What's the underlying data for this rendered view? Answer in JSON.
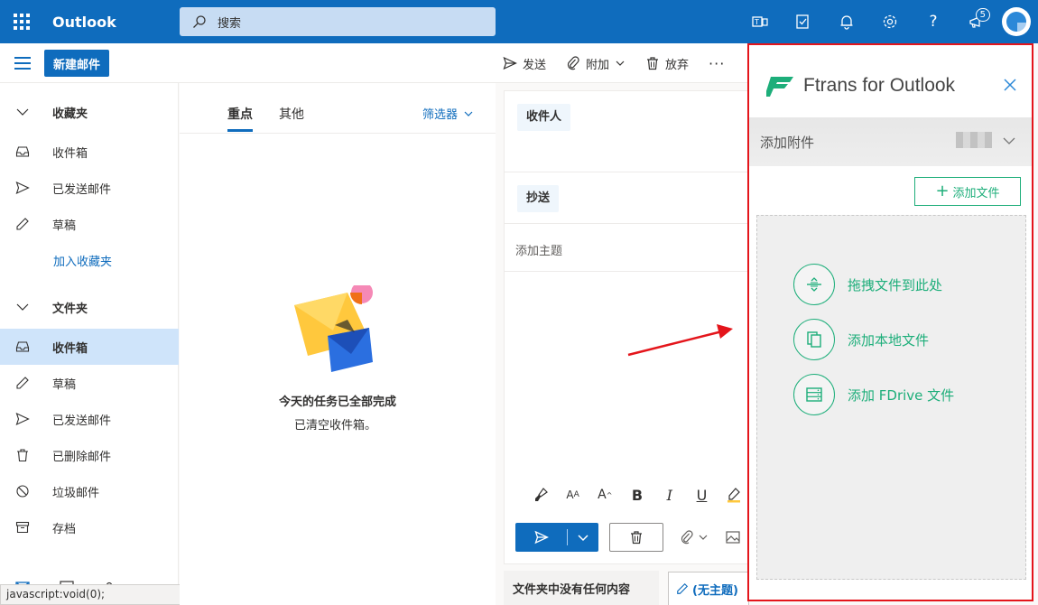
{
  "topbar": {
    "app_name": "Outlook",
    "search_placeholder": "搜索",
    "notification_count": "5"
  },
  "toolbar": {
    "new_mail": "新建邮件",
    "send": "发送",
    "attach": "附加",
    "discard": "放弃",
    "more": "···"
  },
  "sidebar": {
    "favorites_header": "收藏夹",
    "favorites": [
      {
        "label": "收件箱",
        "icon": "inbox-icon"
      },
      {
        "label": "已发送邮件",
        "icon": "send-icon"
      },
      {
        "label": "草稿",
        "icon": "pencil-icon"
      }
    ],
    "add_favorite": "加入收藏夹",
    "folders_header": "文件夹",
    "folders": [
      {
        "label": "收件箱",
        "icon": "inbox-icon"
      },
      {
        "label": "草稿",
        "icon": "pencil-icon"
      },
      {
        "label": "已发送邮件",
        "icon": "send-icon"
      },
      {
        "label": "已删除邮件",
        "icon": "trash-icon"
      },
      {
        "label": "垃圾邮件",
        "icon": "block-icon"
      },
      {
        "label": "存档",
        "icon": "archive-icon"
      }
    ]
  },
  "status_bar": "javascript:void(0);",
  "message_list": {
    "tab_focused": "重点",
    "tab_other": "其他",
    "filter": "筛选器",
    "empty_title": "今天的任务已全部完成",
    "empty_subtitle": "已清空收件箱。",
    "footer_text": "文件夹中没有任何内容"
  },
  "compose": {
    "to_label": "收件人",
    "cc_label": "抄送",
    "subject_placeholder": "添加主题",
    "draft_tab": "(无主题)"
  },
  "panel": {
    "title": "Ftrans for Outlook",
    "section": "添加附件",
    "add_file_button": "添加文件",
    "options": [
      {
        "label": "拖拽文件到此处",
        "icon": "drag-drop-icon"
      },
      {
        "label": "添加本地文件",
        "icon": "copy-files-icon"
      },
      {
        "label": "添加 FDrive 文件",
        "icon": "server-icon"
      }
    ],
    "accent_color": "#1dae7a",
    "border_color": "#e4151b"
  },
  "colors": {
    "brand": "#0f6cbd",
    "selected": "#cfe4fa"
  }
}
